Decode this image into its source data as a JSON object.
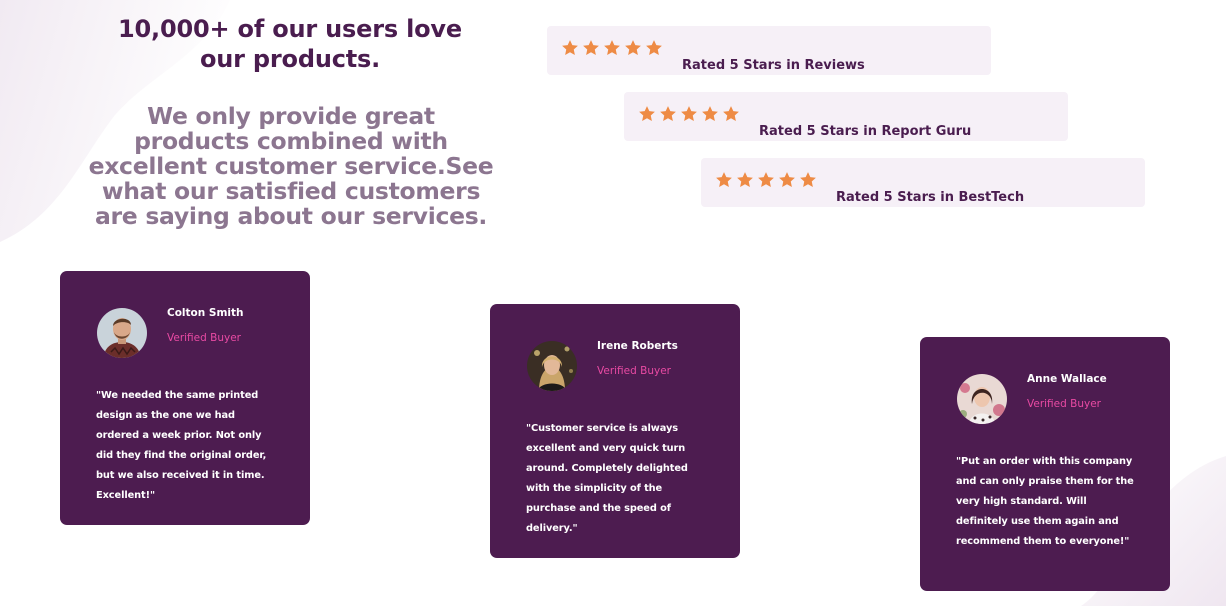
{
  "hero": {
    "title": "10,000+ of our users love our products.",
    "description": "We only provide great products combined with excellent customer service.See what our satisfied customers are saying about our services."
  },
  "ratings": [
    {
      "stars": 5,
      "icon": "star-icon",
      "label": "Rated 5 Stars in Reviews"
    },
    {
      "stars": 5,
      "icon": "star-icon",
      "label": "Rated 5 Stars in Report Guru"
    },
    {
      "stars": 5,
      "icon": "star-icon",
      "label": "Rated 5 Stars in BestTech"
    }
  ],
  "testimonials": [
    {
      "name": "Colton Smith",
      "status": "Verified Buyer",
      "quote": "\"We needed the same printed design as the one we had ordered a week prior. Not only did they find the original order, but we also received it in time. Excellent!\""
    },
    {
      "name": "Irene Roberts",
      "status": "Verified Buyer",
      "quote": "\"Customer service is always excellent and very quick turn around. Completely delighted with the simplicity of the purchase and the speed of delivery.\""
    },
    {
      "name": "Anne Wallace",
      "status": "Verified Buyer",
      "quote": "\"Put an order with this company and can only praise them for the very high standard. Will definitely use them again and recommend them to everyone!\""
    }
  ],
  "colors": {
    "primary": "#4d1c50",
    "heading": "#4a1d4f",
    "muted": "#8c7690",
    "accent": "#e84aa3",
    "star": "#ee8b45",
    "rating_bg": "#f6f0f7"
  }
}
